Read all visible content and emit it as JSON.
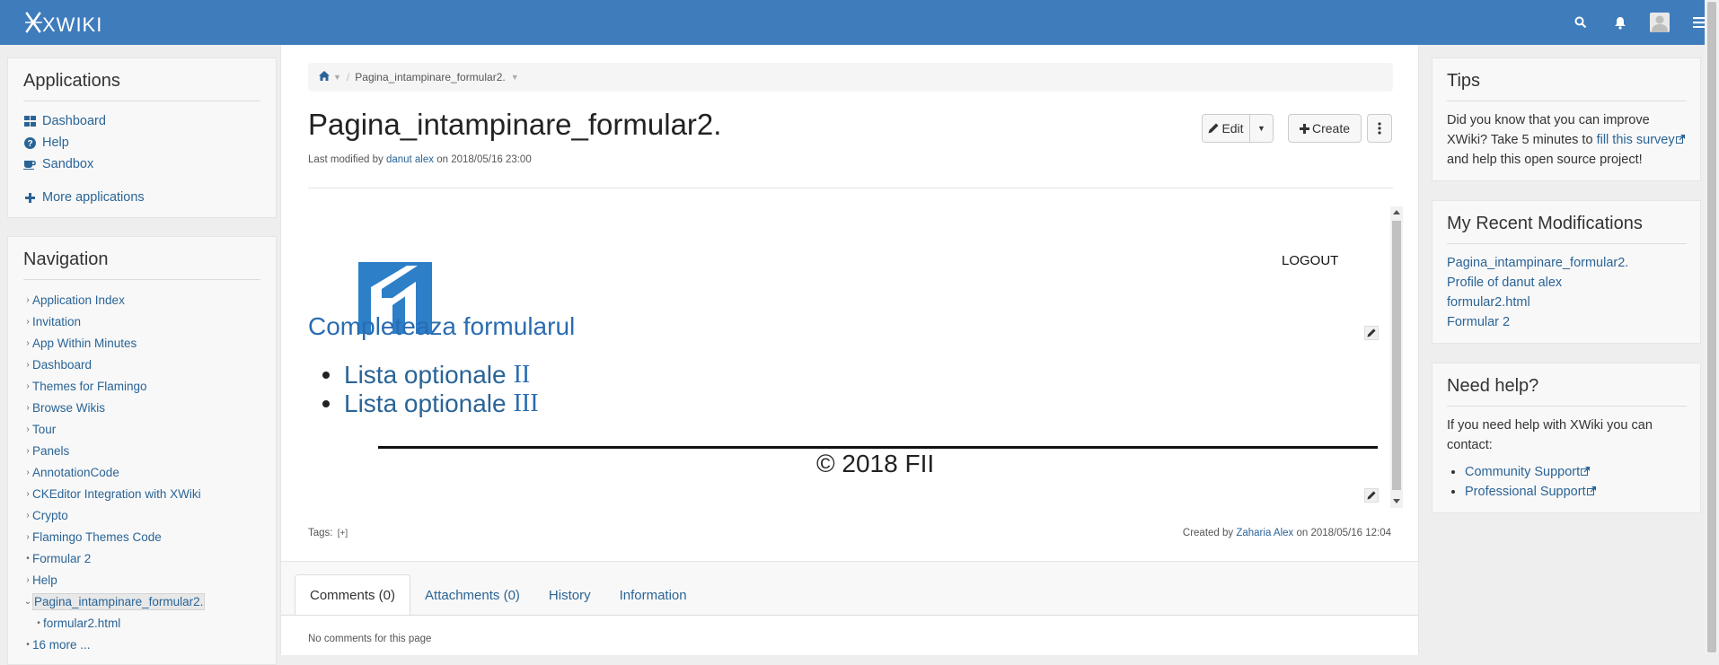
{
  "brand": {
    "name": "XWIKI"
  },
  "topbar": {
    "icons": [
      "search-icon",
      "bell-icon",
      "user-icon",
      "menu-icon"
    ]
  },
  "applications": {
    "title": "Applications",
    "items": [
      {
        "label": "Dashboard",
        "icon": "dashboard-icon"
      },
      {
        "label": "Help",
        "icon": "question-icon"
      },
      {
        "label": "Sandbox",
        "icon": "coffee-icon"
      }
    ],
    "more": "More applications"
  },
  "navigation": {
    "title": "Navigation",
    "items": [
      "Application Index",
      "Invitation",
      "App Within Minutes",
      "Dashboard",
      "Themes for Flamingo",
      "Browse Wikis",
      "Tour",
      "Panels",
      "AnnotationCode",
      "CKEditor Integration with XWiki",
      "Crypto",
      "Flamingo Themes Code",
      "Formular 2",
      "Help",
      "Pagina_intampinare_formular2.",
      "formular2.html",
      "16 more ..."
    ]
  },
  "breadcrumb": {
    "page": "Pagina_intampinare_formular2."
  },
  "page": {
    "title": "Pagina_intampinare_formular2.",
    "modified_prefix": "Last modified by ",
    "modified_by": "danut alex",
    "modified_suffix": " on 2018/05/16 23:00",
    "buttons": {
      "edit": "Edit",
      "create": "Create"
    }
  },
  "content": {
    "logout": "LOGOUT",
    "heading": "Completeaza formularul",
    "list": [
      {
        "text": "Lista optionale ",
        "roman": "II"
      },
      {
        "text": "Lista optionale ",
        "roman": "III"
      }
    ],
    "copyright": "© 2018 FII"
  },
  "footer_meta": {
    "tags_label": "Tags:",
    "tags_add": "[+]",
    "created_prefix": "Created by ",
    "created_by": "Zaharia Alex",
    "created_suffix": " on 2018/05/16 12:04"
  },
  "tabs": [
    {
      "label": "Comments (0)",
      "active": true
    },
    {
      "label": "Attachments (0)",
      "active": false
    },
    {
      "label": "History",
      "active": false
    },
    {
      "label": "Information",
      "active": false
    }
  ],
  "comments": {
    "empty": "No comments for this page"
  },
  "tips": {
    "title": "Tips",
    "text_before": "Did you know that you can improve XWiki? Take 5 minutes to ",
    "link": "fill this survey",
    "text_after": " and help this open source project!"
  },
  "recent": {
    "title": "My Recent Modifications",
    "items": [
      "Pagina_intampinare_formular2.",
      "Profile of danut alex",
      "formular2.html",
      "Formular 2"
    ]
  },
  "help": {
    "title": "Need help?",
    "text": "If you need help with XWiki you can contact:",
    "links": [
      "Community Support",
      "Professional Support"
    ]
  },
  "colors": {
    "topbar": "#3e7cbc",
    "link": "#2a6496",
    "content_link": "#2a6cb1"
  }
}
